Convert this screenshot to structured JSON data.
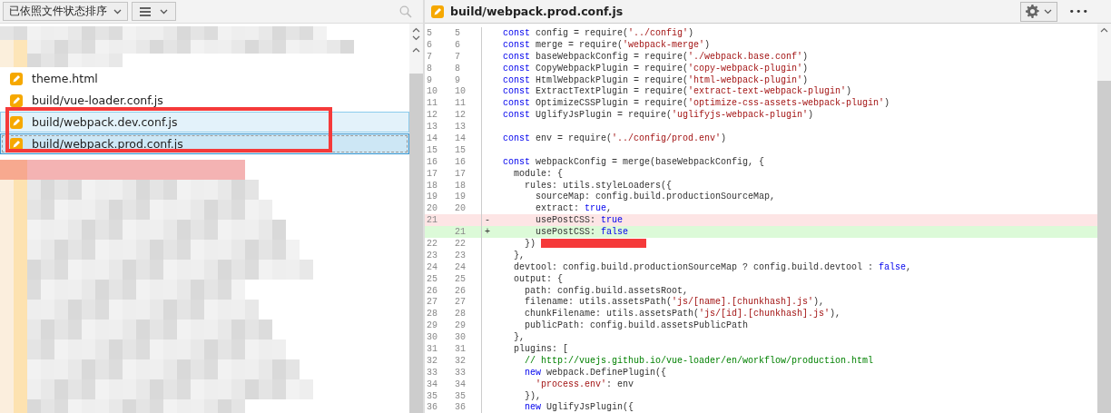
{
  "left_toolbar": {
    "sort_dropdown": "已依照文件状态排序"
  },
  "files": [
    {
      "name": "theme.html",
      "selected": false,
      "focused": false
    },
    {
      "name": "build/vue-loader.conf.js",
      "selected": false,
      "focused": false
    },
    {
      "name": "build/webpack.dev.conf.js",
      "selected": true,
      "focused": false
    },
    {
      "name": "build/webpack.prod.conf.js",
      "selected": true,
      "focused": true
    }
  ],
  "editor": {
    "title": "build/webpack.prod.conf.js",
    "more_button": "•••",
    "lines": [
      {
        "old": "5",
        "new": "5",
        "kind": "context",
        "code": [
          {
            "kind": "keyword",
            "text": "  const"
          },
          {
            "kind": "plain",
            "text": " config = require("
          },
          {
            "kind": "string",
            "text": "'../config'"
          },
          {
            "kind": "plain",
            "text": ")"
          }
        ]
      },
      {
        "old": "6",
        "new": "6",
        "kind": "context",
        "code": [
          {
            "kind": "keyword",
            "text": "  const"
          },
          {
            "kind": "plain",
            "text": " merge = require("
          },
          {
            "kind": "string",
            "text": "'webpack-merge'"
          },
          {
            "kind": "plain",
            "text": ")"
          }
        ]
      },
      {
        "old": "7",
        "new": "7",
        "kind": "context",
        "code": [
          {
            "kind": "keyword",
            "text": "  const"
          },
          {
            "kind": "plain",
            "text": " baseWebpackConfig = require("
          },
          {
            "kind": "string",
            "text": "'./webpack.base.conf'"
          },
          {
            "kind": "plain",
            "text": ")"
          }
        ]
      },
      {
        "old": "8",
        "new": "8",
        "kind": "context",
        "code": [
          {
            "kind": "keyword",
            "text": "  const"
          },
          {
            "kind": "plain",
            "text": " CopyWebpackPlugin = require("
          },
          {
            "kind": "string",
            "text": "'copy-webpack-plugin'"
          },
          {
            "kind": "plain",
            "text": ")"
          }
        ]
      },
      {
        "old": "9",
        "new": "9",
        "kind": "context",
        "code": [
          {
            "kind": "keyword",
            "text": "  const"
          },
          {
            "kind": "plain",
            "text": " HtmlWebpackPlugin = require("
          },
          {
            "kind": "string",
            "text": "'html-webpack-plugin'"
          },
          {
            "kind": "plain",
            "text": ")"
          }
        ]
      },
      {
        "old": "10",
        "new": "10",
        "kind": "context",
        "code": [
          {
            "kind": "keyword",
            "text": "  const"
          },
          {
            "kind": "plain",
            "text": " ExtractTextPlugin = require("
          },
          {
            "kind": "string",
            "text": "'extract-text-webpack-plugin'"
          },
          {
            "kind": "plain",
            "text": ")"
          }
        ]
      },
      {
        "old": "11",
        "new": "11",
        "kind": "context",
        "code": [
          {
            "kind": "keyword",
            "text": "  const"
          },
          {
            "kind": "plain",
            "text": " OptimizeCSSPlugin = require("
          },
          {
            "kind": "string",
            "text": "'optimize-css-assets-webpack-plugin'"
          },
          {
            "kind": "plain",
            "text": ")"
          }
        ]
      },
      {
        "old": "12",
        "new": "12",
        "kind": "context",
        "code": [
          {
            "kind": "keyword",
            "text": "  const"
          },
          {
            "kind": "plain",
            "text": " UglifyJsPlugin = require("
          },
          {
            "kind": "string",
            "text": "'uglifyjs-webpack-plugin'"
          },
          {
            "kind": "plain",
            "text": ")"
          }
        ]
      },
      {
        "old": "13",
        "new": "13",
        "kind": "context"
      },
      {
        "old": "14",
        "new": "14",
        "kind": "context",
        "code": [
          {
            "kind": "keyword",
            "text": "  const"
          },
          {
            "kind": "plain",
            "text": " env = require("
          },
          {
            "kind": "string",
            "text": "'../config/prod.env'"
          },
          {
            "kind": "plain",
            "text": ")"
          }
        ]
      },
      {
        "old": "15",
        "new": "15",
        "kind": "context"
      },
      {
        "old": "16",
        "new": "16",
        "kind": "context",
        "code": [
          {
            "kind": "keyword",
            "text": "  const"
          },
          {
            "kind": "plain",
            "text": " webpackConfig = merge(baseWebpackConfig, {"
          }
        ]
      },
      {
        "old": "17",
        "new": "17",
        "kind": "context",
        "code": [
          {
            "kind": "plain",
            "text": "    module: {"
          }
        ]
      },
      {
        "old": "18",
        "new": "18",
        "kind": "context",
        "code": [
          {
            "kind": "plain",
            "text": "      rules: utils.styleLoaders({"
          }
        ]
      },
      {
        "old": "19",
        "new": "19",
        "kind": "context",
        "code": [
          {
            "kind": "plain",
            "text": "        sourceMap: config.build.productionSourceMap,"
          }
        ]
      },
      {
        "old": "20",
        "new": "20",
        "kind": "context",
        "code": [
          {
            "kind": "plain",
            "text": "        extract: "
          },
          {
            "kind": "keyword",
            "text": "true"
          },
          {
            "kind": "plain",
            "text": ","
          }
        ]
      },
      {
        "old": "21",
        "kind": "removed",
        "marker": "-",
        "code": [
          {
            "kind": "plain",
            "text": "        usePostCSS: "
          },
          {
            "kind": "keyword",
            "text": "true"
          }
        ]
      },
      {
        "new": "21",
        "kind": "added",
        "marker": "+",
        "code": [
          {
            "kind": "plain",
            "text": "        usePostCSS: "
          },
          {
            "kind": "keyword",
            "text": "false"
          }
        ]
      },
      {
        "old": "22",
        "new": "22",
        "kind": "context",
        "redacted": true,
        "code": [
          {
            "kind": "plain",
            "text": "      })"
          }
        ]
      },
      {
        "old": "23",
        "new": "23",
        "kind": "context",
        "code": [
          {
            "kind": "plain",
            "text": "    },"
          }
        ]
      },
      {
        "old": "24",
        "new": "24",
        "kind": "context",
        "code": [
          {
            "kind": "plain",
            "text": "    devtool: config.build.productionSourceMap ? config.build.devtool : "
          },
          {
            "kind": "keyword",
            "text": "false"
          },
          {
            "kind": "plain",
            "text": ","
          }
        ]
      },
      {
        "old": "25",
        "new": "25",
        "kind": "context",
        "code": [
          {
            "kind": "plain",
            "text": "    output: {"
          }
        ]
      },
      {
        "old": "26",
        "new": "26",
        "kind": "context",
        "code": [
          {
            "kind": "plain",
            "text": "      path: config.build.assetsRoot,"
          }
        ]
      },
      {
        "old": "27",
        "new": "27",
        "kind": "context",
        "code": [
          {
            "kind": "plain",
            "text": "      filename: utils.assetsPath("
          },
          {
            "kind": "string",
            "text": "'js/[name].[chunkhash].js'"
          },
          {
            "kind": "plain",
            "text": "),"
          }
        ]
      },
      {
        "old": "28",
        "new": "28",
        "kind": "context",
        "code": [
          {
            "kind": "plain",
            "text": "      chunkFilename: utils.assetsPath("
          },
          {
            "kind": "string",
            "text": "'js/[id].[chunkhash].js'"
          },
          {
            "kind": "plain",
            "text": "),"
          }
        ]
      },
      {
        "old": "29",
        "new": "29",
        "kind": "context",
        "code": [
          {
            "kind": "plain",
            "text": "      publicPath: config.build.assetsPublicPath"
          }
        ]
      },
      {
        "old": "30",
        "new": "30",
        "kind": "context",
        "code": [
          {
            "kind": "plain",
            "text": "    },"
          }
        ]
      },
      {
        "old": "31",
        "new": "31",
        "kind": "context",
        "code": [
          {
            "kind": "plain",
            "text": "    plugins: ["
          }
        ]
      },
      {
        "old": "32",
        "new": "32",
        "kind": "context",
        "code": [
          {
            "kind": "comment",
            "text": "      // http://vuejs.github.io/vue-loader/en/workflow/production.html"
          }
        ]
      },
      {
        "old": "33",
        "new": "33",
        "kind": "context",
        "code": [
          {
            "kind": "keyword",
            "text": "      new"
          },
          {
            "kind": "plain",
            "text": " webpack.DefinePlugin({"
          }
        ]
      },
      {
        "old": "34",
        "new": "34",
        "kind": "context",
        "code": [
          {
            "kind": "string",
            "text": "        'process.env'"
          },
          {
            "kind": "plain",
            "text": ": env"
          }
        ]
      },
      {
        "old": "35",
        "new": "35",
        "kind": "context",
        "code": [
          {
            "kind": "plain",
            "text": "      }),"
          }
        ]
      },
      {
        "old": "36",
        "new": "36",
        "kind": "context",
        "code": [
          {
            "kind": "keyword",
            "text": "      new"
          },
          {
            "kind": "plain",
            "text": " UglifyJsPlugin({"
          }
        ]
      }
    ]
  }
}
